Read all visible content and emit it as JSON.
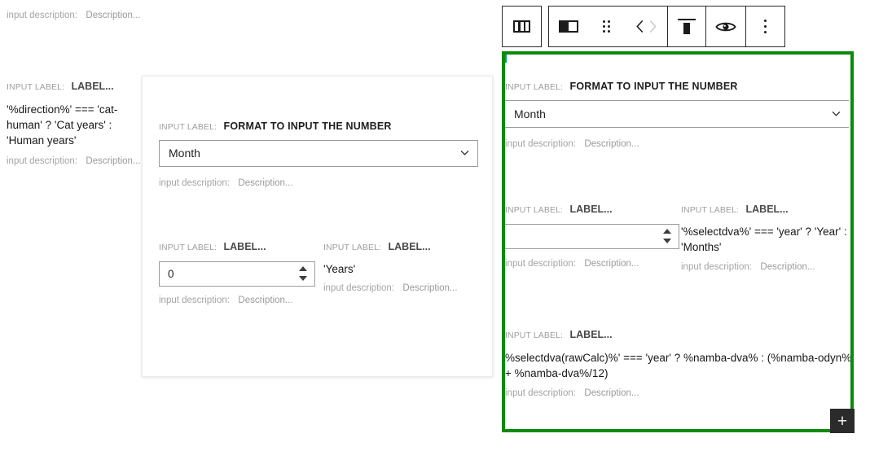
{
  "common": {
    "label_key": "INPUT LABEL:",
    "desc_key": "input description:",
    "desc_value": "Description...",
    "label_placeholder": "LABEL..."
  },
  "colors": {
    "selection_green": "#098a09",
    "accent_teal": "#0a8ea0",
    "add_button_bg": "#2b2b2b",
    "field_border": "#9b9b9b",
    "muted_text": "#9e9e9e"
  },
  "stray": {
    "desc_key": "input description:",
    "desc_value": "Description..."
  },
  "left_column": {
    "label_key": "INPUT LABEL:",
    "label_value": "LABEL...",
    "expression": "'%direction%' === 'cat-human' ? 'Cat years' : 'Human years'",
    "desc_key": "input description:",
    "desc_value": "Description..."
  },
  "card": {
    "format_field": {
      "label_key": "INPUT LABEL:",
      "label_value": "FORMAT TO INPUT THE NUMBER",
      "selected_option": "Month",
      "options": [
        "Month"
      ],
      "chevron_icon": "chevron-down-icon",
      "desc_key": "input description:",
      "desc_value": "Description..."
    },
    "number_field": {
      "label_key": "INPUT LABEL:",
      "label_value": "LABEL...",
      "value": "0",
      "stepper_icon": "stepper-updown-icon",
      "desc_key": "input description:",
      "desc_value": "Description..."
    },
    "years_field": {
      "label_key": "INPUT LABEL:",
      "label_value": "LABEL...",
      "expression": "'Years'",
      "desc_key": "input description:",
      "desc_value": "Description..."
    }
  },
  "toolbar": {
    "buttons": [
      {
        "name": "block-columns-button",
        "icon": "three-columns-icon"
      },
      {
        "name": "block-variation-button",
        "icon": "half-filled-block-icon"
      },
      {
        "name": "drag-handle-button",
        "icon": "drag-dots-icon"
      },
      {
        "name": "move-previous-button",
        "icon": "chevron-left-icon"
      },
      {
        "name": "move-next-button",
        "icon": "chevron-right-icon"
      },
      {
        "name": "align-top-button",
        "icon": "align-top-icon"
      },
      {
        "name": "preview-button",
        "icon": "eye-icon"
      },
      {
        "name": "more-options-button",
        "icon": "kebab-menu-icon"
      }
    ]
  },
  "green_panel": {
    "format_field": {
      "label_key": "INPUT LABEL:",
      "label_value": "FORMAT TO INPUT THE NUMBER",
      "selected_option": "Month",
      "options": [
        "Month"
      ],
      "chevron_icon": "chevron-down-icon",
      "desc_key": "input description:",
      "desc_value": "Description..."
    },
    "number_field": {
      "label_key": "INPUT LABEL:",
      "label_value": "LABEL...",
      "value": "",
      "stepper_icon": "stepper-updown-icon",
      "desc_key": "input description:",
      "desc_value": "Description..."
    },
    "select_expr_field": {
      "label_key": "INPUT LABEL:",
      "label_value": "LABEL...",
      "expression": "'%selectdva%' === 'year' ? 'Year' : 'Months'",
      "desc_key": "input description:",
      "desc_value": "Description..."
    },
    "calc_field": {
      "label_key": "INPUT LABEL:",
      "label_value": "LABEL...",
      "expression": "%selectdva(rawCalc)%' === 'year' ? %namba-dva% : (%namba-odyn% + %namba-dva%/12)",
      "desc_key": "input description:",
      "desc_value": "Description..."
    },
    "add_button_label": "+"
  }
}
